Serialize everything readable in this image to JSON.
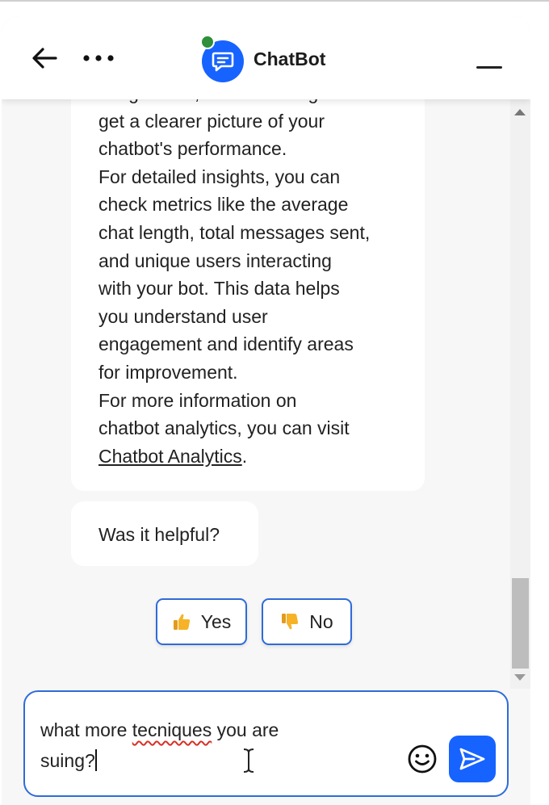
{
  "header": {
    "brand_name": "ChatBot",
    "icons": {
      "back": "arrow-left-icon",
      "more": "more-horizontal-icon",
      "logo": "chat-bubble-icon",
      "minimize": "minimize-icon"
    },
    "status_color": "#2f8f3a",
    "accent_color": "#1763ff"
  },
  "transcript": {
    "answer_partial_first_line": "integrations, and time ranges to",
    "answer_paragraphs": [
      "get a clearer picture of your\nchatbot's performance.",
      "For detailed insights, you can\ncheck metrics like the average\nchat length, total messages sent,\nand unique users interacting\nwith your bot. This data helps\nyou understand user\nengagement and identify areas\nfor improvement."
    ],
    "answer_last_prefix": "For more information on\nchatbot analytics, you can visit\n",
    "answer_link": "Chatbot Analytics",
    "answer_last_suffix": ".",
    "helpful_question": "Was it helpful?",
    "feedback": {
      "yes_label": "Yes",
      "no_label": "No",
      "yes_icon": "thumbs-up-icon",
      "no_icon": "thumbs-down-icon"
    }
  },
  "composer": {
    "text_before": "what more ",
    "misspelled_word": "tecniques",
    "text_after": " you are\nsuing?",
    "icons": {
      "emoji": "smiley-icon",
      "send": "send-icon"
    }
  }
}
